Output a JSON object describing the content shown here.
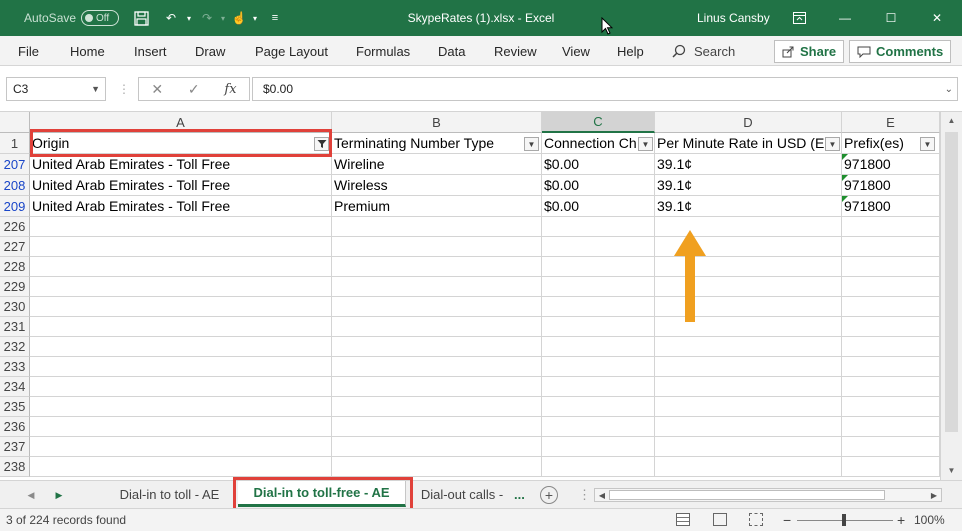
{
  "window": {
    "title": "SkypeRates (1).xlsx  -  Excel",
    "autosave_label": "AutoSave",
    "autosave_state": "Off",
    "user": "Linus Cansby"
  },
  "ribbon": {
    "tabs": [
      "File",
      "Home",
      "Insert",
      "Draw",
      "Page Layout",
      "Formulas",
      "Data",
      "Review",
      "View",
      "Help"
    ],
    "search_label": "Search",
    "share_label": "Share",
    "comments_label": "Comments"
  },
  "formula_bar": {
    "name_box": "C3",
    "fx_label": "fx",
    "formula": "$0.00"
  },
  "sheet": {
    "columns": [
      "A",
      "B",
      "C",
      "D",
      "E"
    ],
    "selected_column": "C",
    "header_row_number": "1",
    "headers": [
      "Origin",
      "Terminating Number Type",
      "Connection Ch",
      "Per Minute Rate in USD (E",
      "Prefix(es)"
    ],
    "filtered_column": "Origin",
    "data_rows": [
      {
        "row": "207",
        "origin": "United Arab Emirates - Toll Free",
        "type": "Wireline",
        "connection": "$0.00",
        "rate": "39.1¢",
        "prefix": "971800"
      },
      {
        "row": "208",
        "origin": "United Arab Emirates - Toll Free",
        "type": "Wireless",
        "connection": "$0.00",
        "rate": "39.1¢",
        "prefix": "971800"
      },
      {
        "row": "209",
        "origin": "United Arab Emirates - Toll Free",
        "type": "Premium",
        "connection": "$0.00",
        "rate": "39.1¢",
        "prefix": "971800"
      }
    ],
    "empty_rows": [
      "226",
      "227",
      "228",
      "229",
      "230",
      "231",
      "232",
      "233",
      "234",
      "235",
      "236",
      "237",
      "238"
    ]
  },
  "sheet_tabs": {
    "tabs": [
      "Dial-in to toll - AE",
      "Dial-in to toll-free - AE",
      "Dial-out calls -"
    ],
    "active": "Dial-in to toll-free - AE",
    "more": "..."
  },
  "status_bar": {
    "text": "3 of 224 records found",
    "zoom": "100%"
  },
  "colors": {
    "excel_green": "#217346",
    "highlight_red": "#e0413a",
    "arrow_orange": "#f0a020"
  },
  "icons": [
    "save-icon",
    "undo-icon",
    "redo-icon",
    "touch-mode-icon",
    "customize-icon",
    "ribbon-display-icon",
    "minimize-icon",
    "maximize-icon",
    "close-icon",
    "search-icon",
    "share-icon",
    "comments-icon",
    "filter-icon",
    "add-sheet-icon"
  ]
}
